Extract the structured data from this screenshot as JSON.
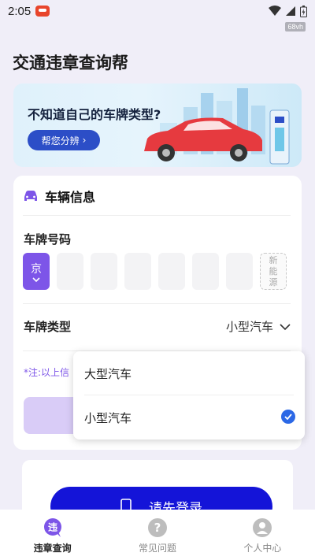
{
  "status_bar": {
    "time": "2:05",
    "speed": "68vh"
  },
  "page": {
    "title": "交通违章查询帮"
  },
  "banner": {
    "title": "不知道自己的车牌类型?",
    "button_label": "帮您分辨"
  },
  "vehicle_card": {
    "header": "车辆信息",
    "plate_label": "车牌号码",
    "province": "京",
    "new_energy_lines": [
      "新",
      "能",
      "源"
    ],
    "plate_type_label": "车牌类型",
    "plate_type_value": "小型汽车",
    "note": "*注:以上信"
  },
  "dropdown": {
    "options": [
      {
        "label": "大型汽车",
        "selected": false
      },
      {
        "label": "小型汽车",
        "selected": true
      }
    ]
  },
  "login": {
    "button_label": "请先登录"
  },
  "tabbar": {
    "tabs": [
      {
        "label": "违章查询",
        "active": true,
        "icon": "violation-icon"
      },
      {
        "label": "常见问题",
        "active": false,
        "icon": "question-icon"
      },
      {
        "label": "个人中心",
        "active": false,
        "icon": "user-icon"
      }
    ]
  },
  "colors": {
    "accent": "#7d55e8",
    "primary_blue": "#1414d8",
    "check_blue": "#2b68e6"
  }
}
